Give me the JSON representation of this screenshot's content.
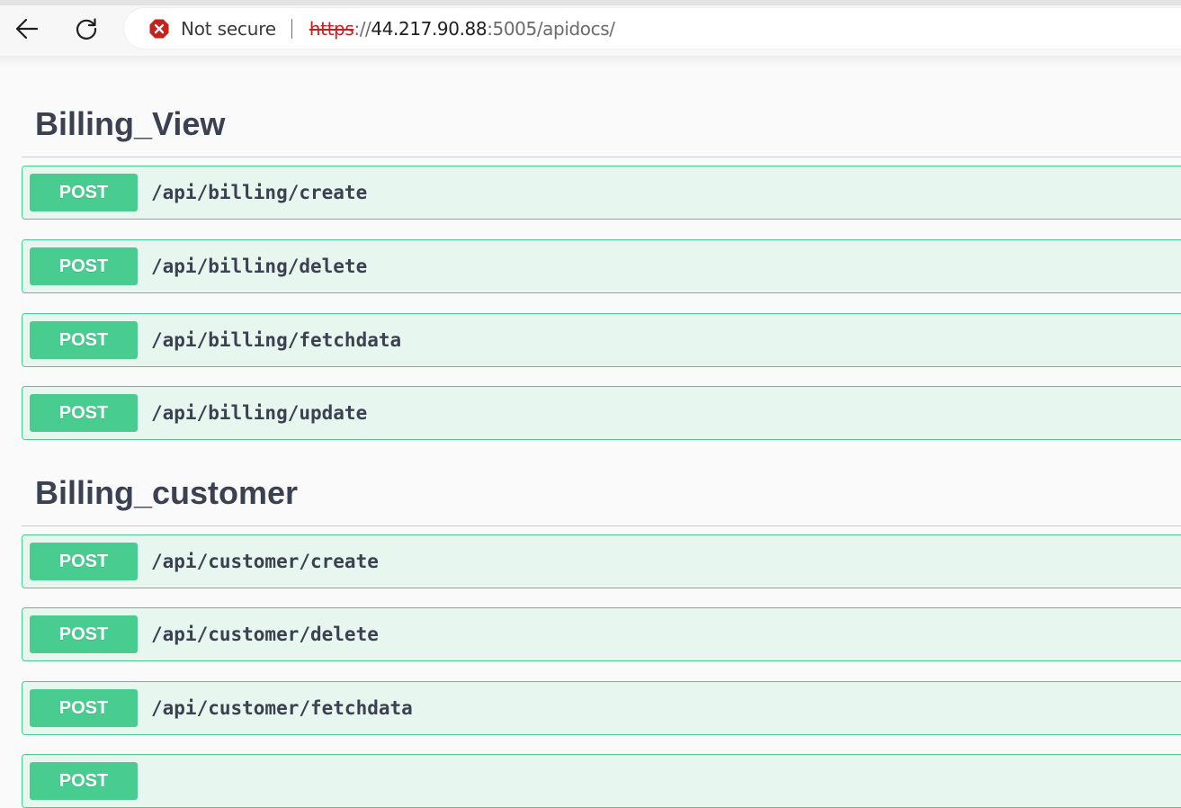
{
  "browser": {
    "security_label": "Not secure",
    "url": {
      "scheme": "https",
      "separator": "://",
      "host": "44.217.90.88",
      "rest": ":5005/apidocs/"
    },
    "icons": {
      "back": "arrow-left-icon",
      "reload": "reload-icon",
      "security": "not-secure-icon"
    },
    "colors": {
      "warning": "#c5221f"
    }
  },
  "sections": [
    {
      "title": "Billing_View",
      "operations": [
        {
          "method": "POST",
          "path": "/api/billing/create"
        },
        {
          "method": "POST",
          "path": "/api/billing/delete"
        },
        {
          "method": "POST",
          "path": "/api/billing/fetchdata"
        },
        {
          "method": "POST",
          "path": "/api/billing/update"
        }
      ]
    },
    {
      "title": "Billing_customer",
      "operations": [
        {
          "method": "POST",
          "path": "/api/customer/create"
        },
        {
          "method": "POST",
          "path": "/api/customer/delete"
        },
        {
          "method": "POST",
          "path": "/api/customer/fetchdata"
        },
        {
          "method": "POST",
          "path": ""
        }
      ]
    }
  ],
  "colors": {
    "post_method": "#49cc90",
    "post_background": "#e8f6f0",
    "heading_text": "#3b4151"
  }
}
